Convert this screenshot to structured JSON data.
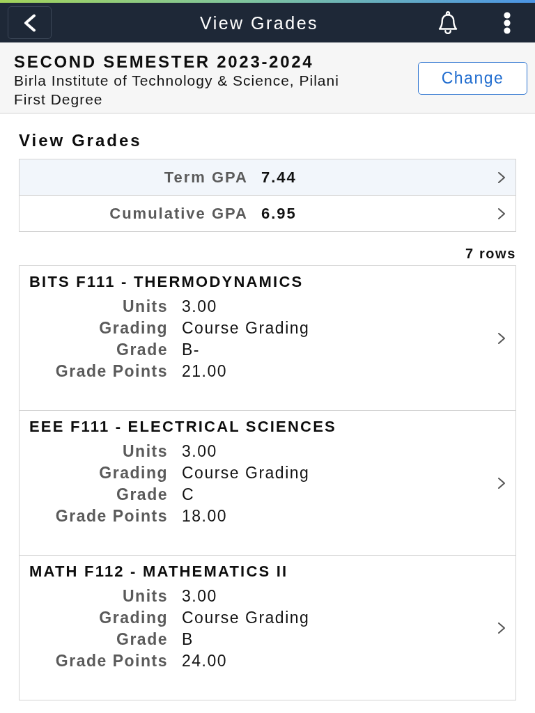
{
  "nav": {
    "title": "View Grades"
  },
  "header": {
    "term": "SECOND SEMESTER 2023-2024",
    "institution": "Birla Institute of Technology & Science, Pilani",
    "career": "First Degree",
    "button": "Change"
  },
  "section_title": "View Grades",
  "gpa_rows": [
    {
      "label": "Term GPA",
      "value": "7.44",
      "selected": true
    },
    {
      "label": "Cumulative GPA",
      "value": "6.95",
      "selected": false
    }
  ],
  "row_count": "7 rows",
  "courses": [
    {
      "title": "BITS F111 - THERMODYNAMICS",
      "fields": [
        {
          "label": "Units",
          "value": "3.00"
        },
        {
          "label": "Grading",
          "value": "Course Grading"
        },
        {
          "label": "Grade",
          "value": "B-"
        },
        {
          "label": "Grade Points",
          "value": "21.00"
        }
      ]
    },
    {
      "title": "EEE F111 - ELECTRICAL SCIENCES",
      "fields": [
        {
          "label": "Units",
          "value": "3.00"
        },
        {
          "label": "Grading",
          "value": "Course Grading"
        },
        {
          "label": "Grade",
          "value": "C"
        },
        {
          "label": "Grade Points",
          "value": "18.00"
        }
      ]
    },
    {
      "title": "MATH F112 - MATHEMATICS II",
      "fields": [
        {
          "label": "Units",
          "value": "3.00"
        },
        {
          "label": "Grading",
          "value": "Course Grading"
        },
        {
          "label": "Grade",
          "value": "B"
        },
        {
          "label": "Grade Points",
          "value": "24.00"
        }
      ]
    }
  ]
}
